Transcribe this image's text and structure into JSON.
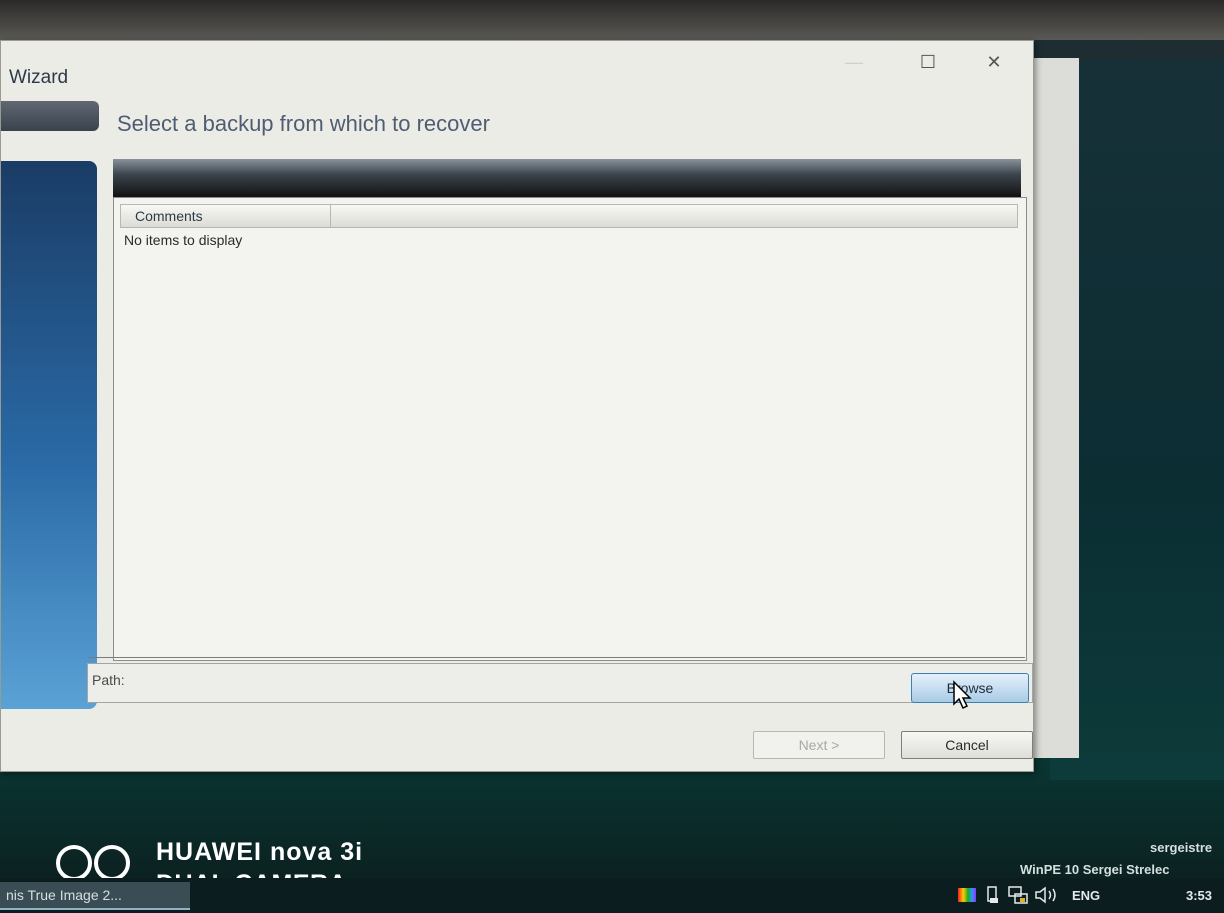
{
  "window": {
    "title": "Wizard",
    "controls": {
      "minimize": "—",
      "maximize": "☐",
      "close": "✕"
    }
  },
  "wizard": {
    "heading": "Select a backup from which to recover",
    "columns": [
      "Comments"
    ],
    "empty_message": "No items to display",
    "path_label": "Path:",
    "path_value": "",
    "browse_label": "Browse",
    "next_label": "Next >",
    "cancel_label": "Cancel"
  },
  "watermark": {
    "brand": "HUAWEI nova 3i",
    "camera": "DUAL CAMERA"
  },
  "desktop": {
    "user": "sergeistre",
    "edition": "WinPE 10 Sergei Strelec"
  },
  "taskbar": {
    "task": "nis True Image 2...",
    "language": "ENG",
    "time": "3:53"
  },
  "colors": {
    "accent": "#3c7fb1",
    "window_bg": "#ecece7",
    "taskbar_bg": "#0c1d20"
  }
}
